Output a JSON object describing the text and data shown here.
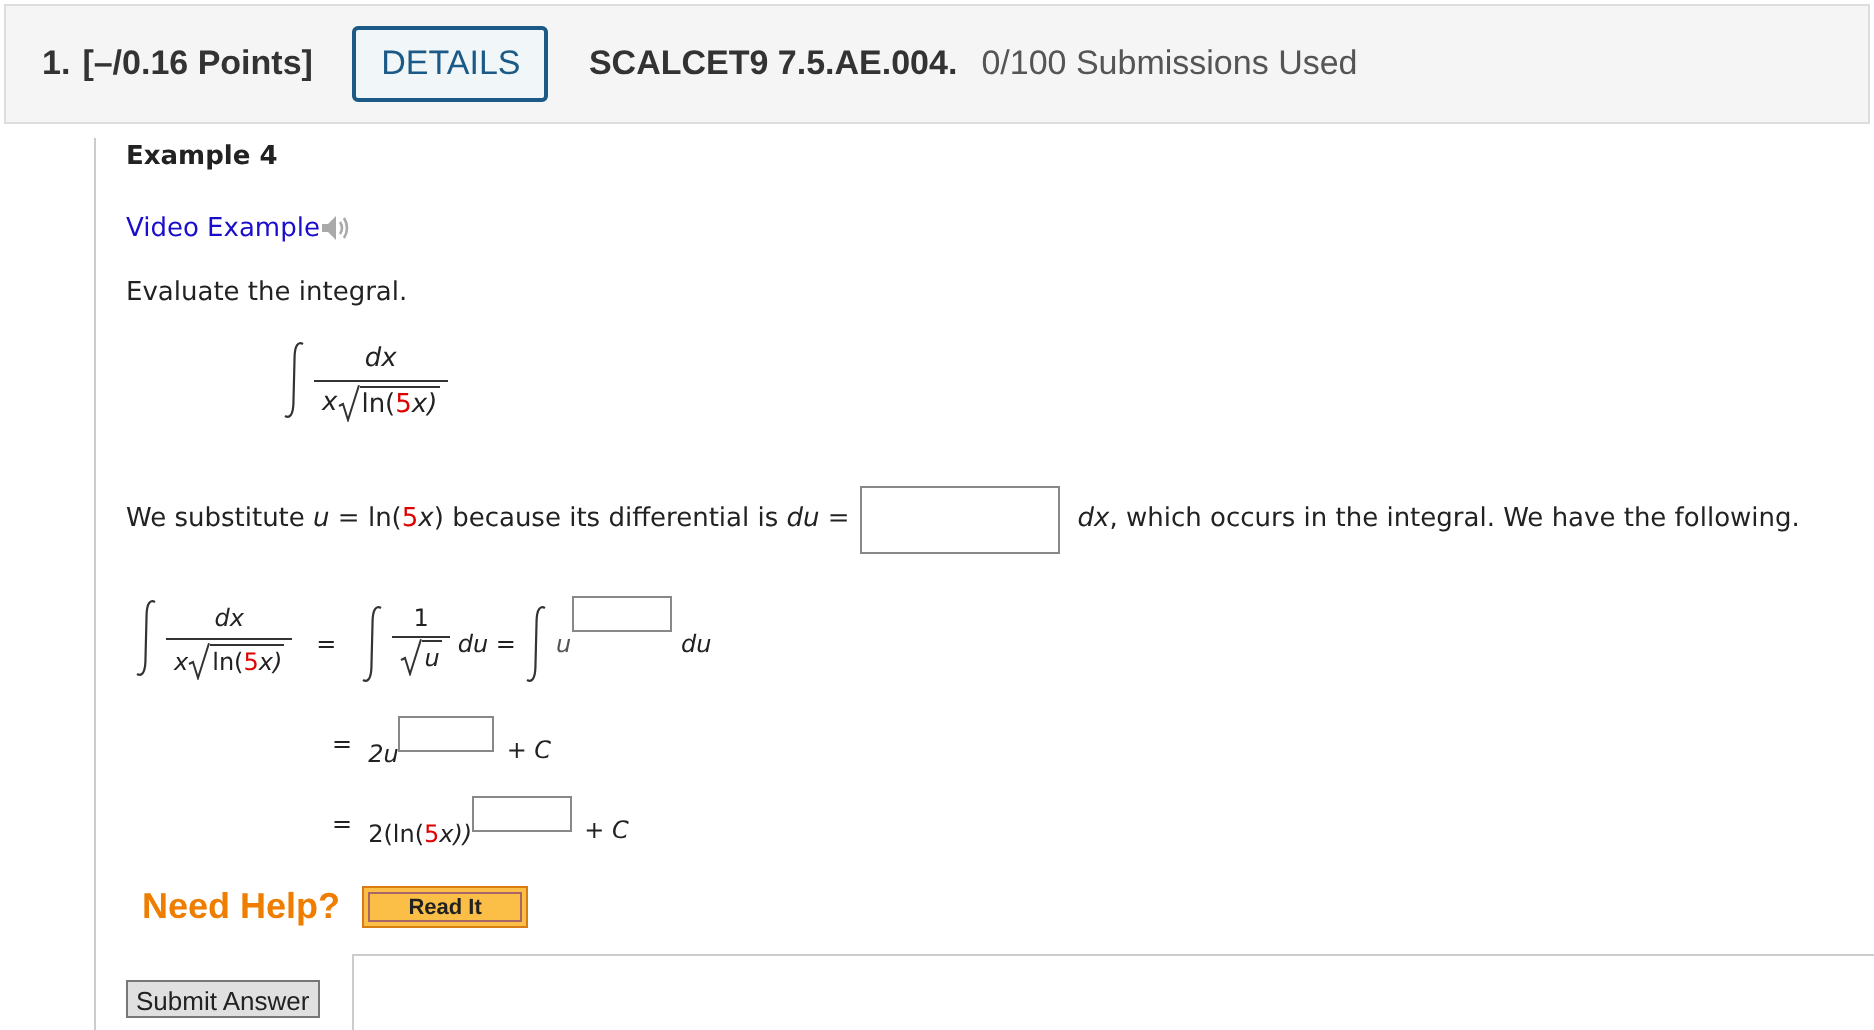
{
  "header": {
    "number": "1.",
    "points": "[–/0.16 Points]",
    "details_button": "DETAILS",
    "code": "SCALCET9 7.5.AE.004.",
    "submissions": "0/100 Submissions Used"
  },
  "example": {
    "title": "Example 4",
    "video_link": "Video Example",
    "prompt": "Evaluate the integral.",
    "integral": {
      "numerator": "dx",
      "factor": "x",
      "fn_open": "ln(",
      "coefficient": "5",
      "fn_close": "x)"
    },
    "substitution": {
      "start": "We substitute *u* = ln(",
      "coefficient": "5",
      "middle": "*x*) because its differential is *du* =",
      "end": "*dx*, which occurs in the integral. We have the following."
    },
    "steps": {
      "lhs": {
        "numerator": "dx",
        "factor": "x",
        "fn_open": "ln(",
        "coefficient": "5",
        "fn_close": "x)"
      },
      "equals": [
        "=",
        "=",
        "="
      ],
      "line1": {
        "numerator": "1",
        "denominator": "u",
        "du_1": "du =",
        "base": "u",
        "du_2": "du"
      },
      "line2": {
        "lead": "2u",
        "tail": "+ C"
      },
      "line3": {
        "lead": "2(ln(",
        "coefficient": "5",
        "after": "x))",
        "tail": "+ C"
      }
    },
    "help": {
      "label": "Need Help?",
      "read_button": "Read It"
    },
    "submit_button": "Submit Answer"
  }
}
